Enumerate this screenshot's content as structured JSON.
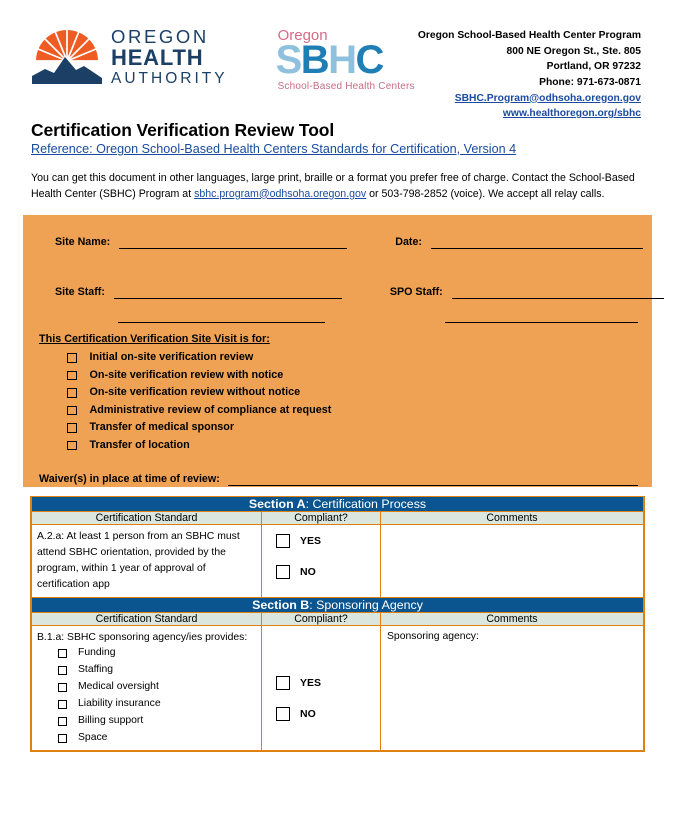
{
  "header": {
    "oha_logo": {
      "line1": "OREGON",
      "line2": "HEALTH",
      "line3": "AUTHORITY",
      "color": "#1c3f66",
      "sun_color": "#ef5c23"
    },
    "sbhc_logo": {
      "oregon": "Oregon",
      "letters": "SBHC",
      "tagline": "School-Based Health Centers",
      "light_blue": "#8fc0dd",
      "dark_blue": "#1f7fb5",
      "pink": "#d86a86"
    },
    "contact": {
      "program": "Oregon School-Based Health Center Program",
      "street": "800 NE Oregon St., Ste. 805",
      "city": "Portland, OR 97232",
      "phone": "Phone: 971-673-0871",
      "email": "SBHC.Program@odhsoha.oregon.gov",
      "website": "www.healthoregon.org/sbhc"
    }
  },
  "title": {
    "heading": "Certification Verification Review Tool",
    "reference": "Reference:  Oregon School-Based Health Centers Standards for Certification, Version 4"
  },
  "notice": {
    "part1": "You can get this document in other languages, large print, braille or a format you prefer free of charge. Contact the School-Based Health Center (SBHC) Program at ",
    "email": "sbhc.program@odhsoha.oregon.gov",
    "part2": " or 503-798-2852 (voice). We accept all relay calls."
  },
  "orange_block": {
    "background": "#efa254",
    "site_name_label": "Site Name:",
    "site_name_value": "",
    "date_label": "Date:",
    "date_value": "",
    "site_staff_label": "Site Staff:",
    "site_staff_value": "",
    "site_staff_value2": "",
    "spo_staff_label": "SPO Staff:",
    "spo_staff_value": "",
    "spo_staff_value2": "",
    "visit_for_heading": "This Certification Verification Site Visit is for:",
    "visit_options": [
      "Initial on-site verification review",
      "On-site verification review with notice",
      "On-site verification review without notice",
      "Administrative review of compliance at request",
      "Transfer of medical sponsor",
      "Transfer of location"
    ],
    "waiver_label": "Waiver(s) in place at time of review:",
    "waiver_value": ""
  },
  "table": {
    "colors": {
      "section_header_bg": "#0a5490",
      "column_header_bg": "#dbe7de",
      "border": "#e0800f"
    },
    "columns": [
      "Certification Standard",
      "Compliant?",
      "Comments"
    ],
    "yes_label": "YES",
    "no_label": "NO",
    "sections": [
      {
        "label": "Section A",
        "name": ": Certification Process",
        "rows": [
          {
            "standard": "A.2.a:  At least 1 person from an SBHC must attend SBHC orientation, provided by the program, within 1 year of approval of certification app",
            "sub_items": [],
            "comments": ""
          }
        ]
      },
      {
        "label": "Section B",
        "name": ": Sponsoring Agency",
        "rows": [
          {
            "standard": "B.1.a:  SBHC sponsoring agency/ies provides:",
            "sub_items": [
              "Funding",
              "Staffing",
              "Medical oversight",
              "Liability insurance",
              "Billing support",
              "Space"
            ],
            "comments": "Sponsoring agency:"
          }
        ]
      }
    ]
  }
}
